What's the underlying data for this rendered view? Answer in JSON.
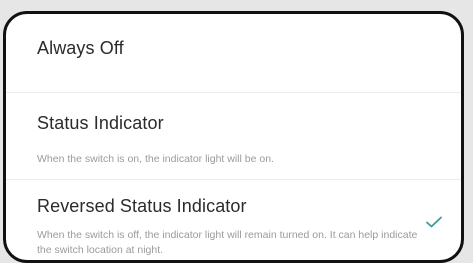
{
  "options": [
    {
      "title": "Always Off",
      "description": "",
      "selected": false
    },
    {
      "title": "Status Indicator",
      "description": "When the switch is on, the indicator light will be on.",
      "selected": false
    },
    {
      "title": "Reversed Status Indicator",
      "description": "When the switch is off, the indicator light will remain turned on. It can help indicate the switch location at night.",
      "selected": true
    }
  ],
  "colors": {
    "accent": "#3a9c98",
    "title_text": "#2b2b2b",
    "description_text": "#9b9b9b"
  },
  "icons": {
    "selected": "checkmark-icon"
  }
}
